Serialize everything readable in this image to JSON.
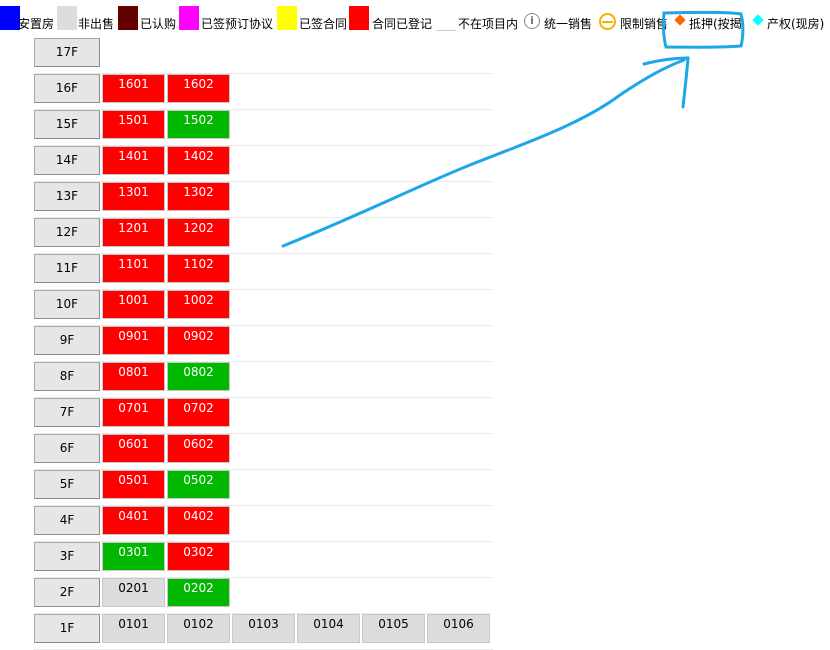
{
  "legend": {
    "items": [
      {
        "label": "安置房",
        "color": "#0000ff"
      },
      {
        "label": "非出售",
        "color": "#dddddd"
      },
      {
        "label": "已认购",
        "color": "#660000"
      },
      {
        "label": "已签预订协议",
        "color": "#ff00ff"
      },
      {
        "label": "已签合同",
        "color": "#ffff00"
      },
      {
        "label": "合同已登记",
        "color": "#ff0000"
      },
      {
        "label": "不在项目内",
        "color": "#ffffff"
      }
    ],
    "icon_items": [
      {
        "label": "统一销售",
        "icon": "info-icon"
      },
      {
        "label": "限制销售",
        "icon": "limit-icon"
      },
      {
        "label": "抵押(按揭",
        "icon": "orange-diamond-icon",
        "color": "#ff6600"
      },
      {
        "label": "产权(现房)",
        "icon": "cyan-diamond-icon",
        "color": "#00ffff"
      }
    ]
  },
  "floors": [
    {
      "floor": "17F",
      "units": []
    },
    {
      "floor": "16F",
      "units": [
        {
          "no": "1601",
          "status": "red"
        },
        {
          "no": "1602",
          "status": "red"
        }
      ]
    },
    {
      "floor": "15F",
      "units": [
        {
          "no": "1501",
          "status": "red"
        },
        {
          "no": "1502",
          "status": "green"
        }
      ]
    },
    {
      "floor": "14F",
      "units": [
        {
          "no": "1401",
          "status": "red"
        },
        {
          "no": "1402",
          "status": "red"
        }
      ]
    },
    {
      "floor": "13F",
      "units": [
        {
          "no": "1301",
          "status": "red"
        },
        {
          "no": "1302",
          "status": "red"
        }
      ]
    },
    {
      "floor": "12F",
      "units": [
        {
          "no": "1201",
          "status": "red"
        },
        {
          "no": "1202",
          "status": "red"
        }
      ]
    },
    {
      "floor": "11F",
      "units": [
        {
          "no": "1101",
          "status": "red"
        },
        {
          "no": "1102",
          "status": "red"
        }
      ]
    },
    {
      "floor": "10F",
      "units": [
        {
          "no": "1001",
          "status": "red"
        },
        {
          "no": "1002",
          "status": "red"
        }
      ]
    },
    {
      "floor": "9F",
      "units": [
        {
          "no": "0901",
          "status": "red"
        },
        {
          "no": "0902",
          "status": "red"
        }
      ]
    },
    {
      "floor": "8F",
      "units": [
        {
          "no": "0801",
          "status": "red"
        },
        {
          "no": "0802",
          "status": "green"
        }
      ]
    },
    {
      "floor": "7F",
      "units": [
        {
          "no": "0701",
          "status": "red"
        },
        {
          "no": "0702",
          "status": "red"
        }
      ]
    },
    {
      "floor": "6F",
      "units": [
        {
          "no": "0601",
          "status": "red"
        },
        {
          "no": "0602",
          "status": "red"
        }
      ]
    },
    {
      "floor": "5F",
      "units": [
        {
          "no": "0501",
          "status": "red"
        },
        {
          "no": "0502",
          "status": "green"
        }
      ]
    },
    {
      "floor": "4F",
      "units": [
        {
          "no": "0401",
          "status": "red"
        },
        {
          "no": "0402",
          "status": "red"
        }
      ]
    },
    {
      "floor": "3F",
      "units": [
        {
          "no": "0301",
          "status": "green"
        },
        {
          "no": "0302",
          "status": "red"
        }
      ]
    },
    {
      "floor": "2F",
      "units": [
        {
          "no": "0201",
          "status": "gray"
        },
        {
          "no": "0202",
          "status": "green"
        }
      ]
    },
    {
      "floor": "1F",
      "units": [
        {
          "no": "0101",
          "status": "gray"
        },
        {
          "no": "0102",
          "status": "gray"
        },
        {
          "no": "0103",
          "status": "gray"
        },
        {
          "no": "0104",
          "status": "gray"
        },
        {
          "no": "0105",
          "status": "gray"
        },
        {
          "no": "0106",
          "status": "gray"
        }
      ]
    }
  ],
  "colors": {
    "red": "#fe0000",
    "green": "#00b800",
    "gray": "#dcdcdc",
    "annotation": "#1ea7e8"
  }
}
